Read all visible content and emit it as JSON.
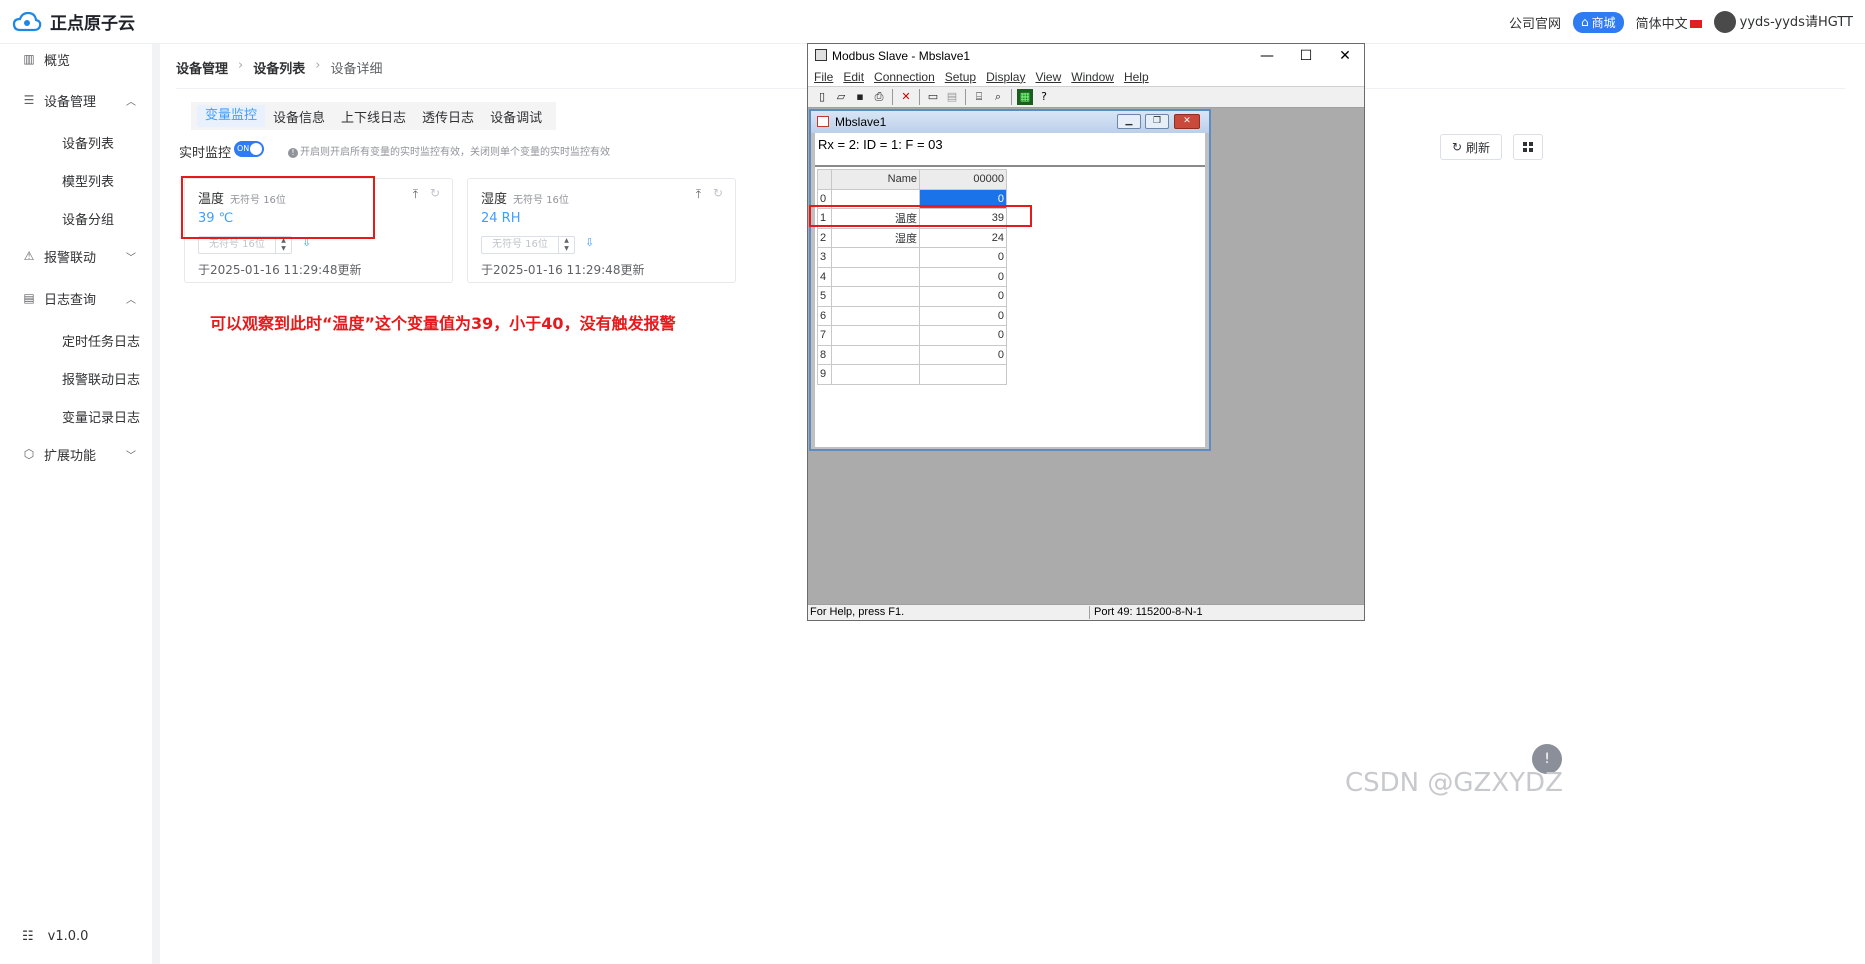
{
  "topbar": {
    "brand": "正点原子云",
    "links": {
      "company": "公司官网",
      "mall": "商城",
      "language": "简体中文",
      "user": "yyds-yyds请HGTT"
    }
  },
  "sidebar": {
    "items": [
      {
        "label": "概览",
        "icon": "bar-chart-icon"
      },
      {
        "label": "设备管理",
        "icon": "server-icon",
        "children": [
          "设备列表",
          "模型列表",
          "设备分组"
        ]
      },
      {
        "label": "报警联动",
        "icon": "alarm-icon"
      },
      {
        "label": "日志查询",
        "icon": "log-icon",
        "children": [
          "定时任务日志",
          "报警联动日志",
          "变量记录日志"
        ]
      },
      {
        "label": "扩展功能",
        "icon": "cube-icon"
      }
    ],
    "version": "v1.0.0"
  },
  "breadcrumb": [
    "设备管理",
    "设备列表",
    "设备详细"
  ],
  "tabs": [
    "变量监控",
    "设备信息",
    "上下线日志",
    "透传日志",
    "设备调试"
  ],
  "monitor": {
    "label": "实时监控",
    "switch": "ON",
    "hint": "开启则开启所有变量的实时监控有效，关闭则单个变量的实时监控有效"
  },
  "cards": [
    {
      "name": "温度",
      "type": "无符号 16位",
      "value": "39 ℃",
      "input_placeholder": "无符号 16位",
      "updated": "于2025-01-16 11:29:48更新"
    },
    {
      "name": "湿度",
      "type": "无符号 16位",
      "value": "24 RH",
      "input_placeholder": "无符号 16位",
      "updated": "于2025-01-16 11:29:48更新"
    }
  ],
  "annotation": "可以观察到此时“温度”这个变量值为39，小于40，没有触发报警",
  "buttons": {
    "refresh": "刷新"
  },
  "modbus": {
    "title": "Modbus Slave - Mbslave1",
    "menu": [
      "File",
      "Edit",
      "Connection",
      "Setup",
      "Display",
      "View",
      "Window",
      "Help"
    ],
    "child_title": "Mbslave1",
    "rx_line": "Rx = 2: ID = 1: F = 03",
    "grid_header": {
      "name": "Name",
      "value": "00000"
    },
    "rows": [
      {
        "idx": "0",
        "name": "",
        "value": "0"
      },
      {
        "idx": "1",
        "name": "温度",
        "value": "39"
      },
      {
        "idx": "2",
        "name": "湿度",
        "value": "24"
      },
      {
        "idx": "3",
        "name": "",
        "value": "0"
      },
      {
        "idx": "4",
        "name": "",
        "value": "0"
      },
      {
        "idx": "5",
        "name": "",
        "value": "0"
      },
      {
        "idx": "6",
        "name": "",
        "value": "0"
      },
      {
        "idx": "7",
        "name": "",
        "value": "0"
      },
      {
        "idx": "8",
        "name": "",
        "value": "0"
      },
      {
        "idx": "9",
        "name": "",
        "value": ""
      }
    ],
    "status_left": "For Help, press F1.",
    "status_right": "Port 49: 115200-8-N-1"
  },
  "watermark": "CSDN @GZXYDZ",
  "colors": {
    "accent": "#409eff",
    "annotation": "#e8191a",
    "selected_cell": "#1a73e8"
  }
}
